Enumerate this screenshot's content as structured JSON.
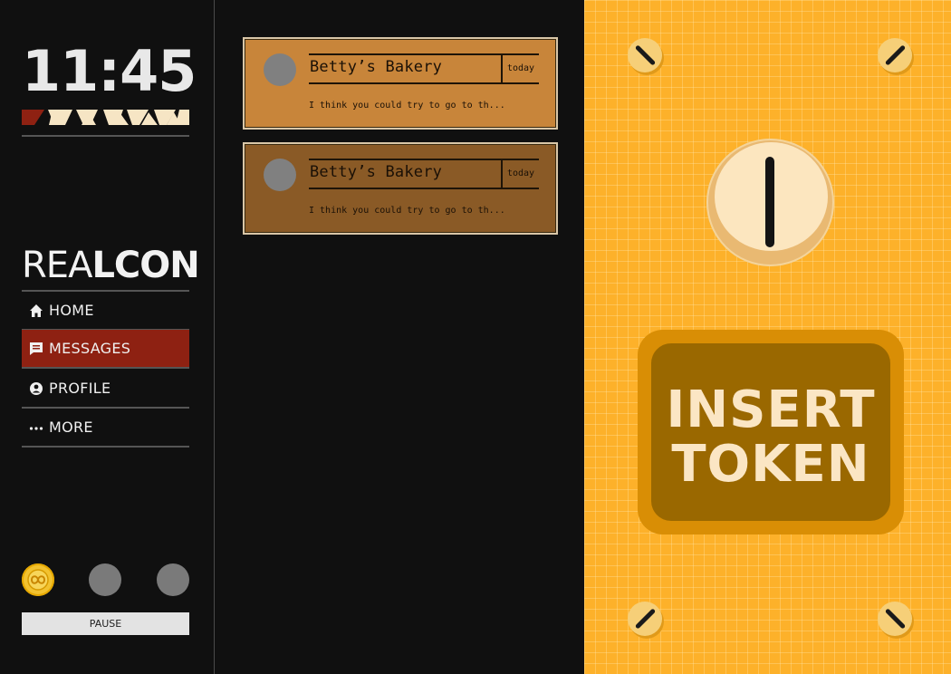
{
  "clock": {
    "time": "11:45"
  },
  "brand": {
    "part1": "REA",
    "part2": "LCON"
  },
  "nav": {
    "items": [
      {
        "label": "HOME",
        "icon": "home-icon",
        "active": false
      },
      {
        "label": "MESSAGES",
        "icon": "message-icon",
        "active": true
      },
      {
        "label": "PROFILE",
        "icon": "user-circle-icon",
        "active": false
      },
      {
        "label": "MORE",
        "icon": "ellipsis-icon",
        "active": false
      }
    ]
  },
  "tokens": {
    "filled": 1,
    "total": 3,
    "coin_icon": "infinity-coin-icon"
  },
  "pause": {
    "label": "PAUSE"
  },
  "messages": [
    {
      "sender": "Betty’s Bakery",
      "date": "today",
      "preview": "I think you could try to go to th..."
    },
    {
      "sender": "Betty’s Bakery",
      "date": "today",
      "preview": "I think you could try to go to th..."
    }
  ],
  "token_panel": {
    "button_line1": "INSERT",
    "button_line2": "TOKEN"
  },
  "colors": {
    "background": "#101010",
    "active_nav": "#8e2112",
    "card_unread": "#c8853a",
    "card_read": "#8a5a26",
    "panel": "#fdb12a",
    "button_outer": "#d98e05",
    "button_inner": "#9a6800",
    "coin_gold": "#f2c230"
  }
}
